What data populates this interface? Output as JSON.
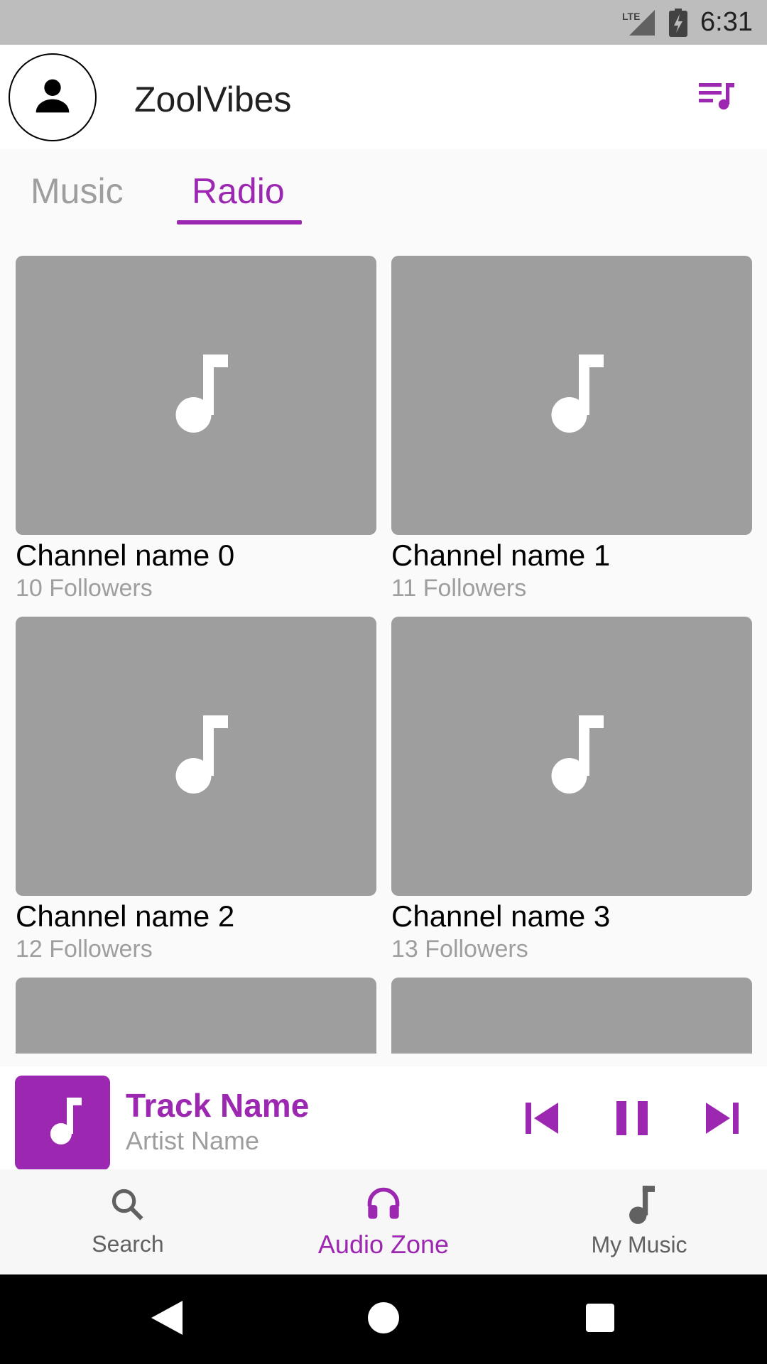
{
  "status_bar": {
    "time": "6:31",
    "network_label": "LTE",
    "icons": [
      "lte-signal-icon",
      "battery-charging-icon"
    ]
  },
  "app_bar": {
    "title": "ZoolVibes",
    "avatar_icon": "person-icon",
    "action_icon": "queue-music-icon"
  },
  "tabs": {
    "items": [
      {
        "label": "Music",
        "selected": false
      },
      {
        "label": "Radio",
        "selected": true
      }
    ]
  },
  "channels": [
    {
      "name": "Channel name 0",
      "followers": "10 Followers"
    },
    {
      "name": "Channel name 1",
      "followers": "11 Followers"
    },
    {
      "name": "Channel name 2",
      "followers": "12 Followers"
    },
    {
      "name": "Channel name 3",
      "followers": "13 Followers"
    },
    {
      "name": "",
      "followers": ""
    },
    {
      "name": "",
      "followers": ""
    }
  ],
  "mini_player": {
    "track_name": "Track Name",
    "artist_name": "Artist Name",
    "state": "playing",
    "controls": [
      "skip-previous-icon",
      "pause-icon",
      "skip-next-icon"
    ]
  },
  "bottom_nav": {
    "items": [
      {
        "label": "Search",
        "icon": "search-icon",
        "active": false
      },
      {
        "label": "Audio Zone",
        "icon": "headphones-icon",
        "active": true
      },
      {
        "label": "My Music",
        "icon": "music-note-icon",
        "active": false
      }
    ]
  },
  "colors": {
    "accent": "#9C27B0",
    "placeholder": "#9E9E9E",
    "status_bar": "#BDBDBD"
  }
}
